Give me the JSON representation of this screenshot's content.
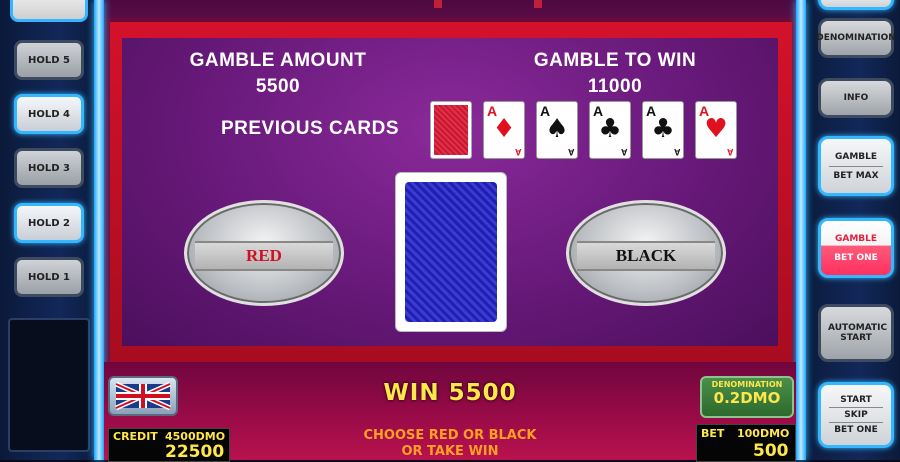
{
  "left_panel": {
    "holds": [
      {
        "label": "HOLD 5"
      },
      {
        "label": "HOLD 4"
      },
      {
        "label": "HOLD 3"
      },
      {
        "label": "HOLD 2"
      },
      {
        "label": "HOLD 1"
      }
    ]
  },
  "right_panel": {
    "denomination": "DENOMINATION",
    "info": "INFO",
    "gamble_bet_max": {
      "top": "GAMBLE",
      "bottom": "BET MAX"
    },
    "gamble_bet_one": {
      "top": "GAMBLE",
      "bottom": "BET ONE"
    },
    "automatic_start": "AUTOMATIC START",
    "start_skip_bet": {
      "top": "START",
      "mid": "SKIP",
      "bottom": "BET ONE"
    }
  },
  "gamble": {
    "amount_label": "GAMBLE AMOUNT",
    "amount_value": "5500",
    "to_win_label": "GAMBLE TO WIN",
    "to_win_value": "11000",
    "previous_cards_label": "PREVIOUS CARDS",
    "previous_cards": [
      {
        "rank": "A",
        "suit": "♦",
        "color": "#e0101e"
      },
      {
        "rank": "A",
        "suit": "♠",
        "color": "#111111"
      },
      {
        "rank": "A",
        "suit": "♣",
        "color": "#111111"
      },
      {
        "rank": "A",
        "suit": "♣",
        "color": "#111111"
      },
      {
        "rank": "A",
        "suit": "♥",
        "color": "#e0101e"
      }
    ],
    "red_button": "RED",
    "black_button": "BLACK"
  },
  "bottom": {
    "win_text": "WIN 5500",
    "denomination_label": "DENOMINATION",
    "denomination_value": "0.2DMO",
    "credit_label": "CREDIT",
    "credit_dmo": "4500DMO",
    "credit_value": "22500",
    "message_line1": "CHOOSE RED OR BLACK",
    "message_line2": "OR TAKE WIN",
    "bet_label": "BET",
    "bet_dmo": "100DMO",
    "bet_value": "500"
  },
  "colors": {
    "accent_blue": "#33b8ff",
    "frame_red": "#d3122a",
    "text_yellow": "#ffe64a",
    "message_orange": "#ffa020"
  }
}
